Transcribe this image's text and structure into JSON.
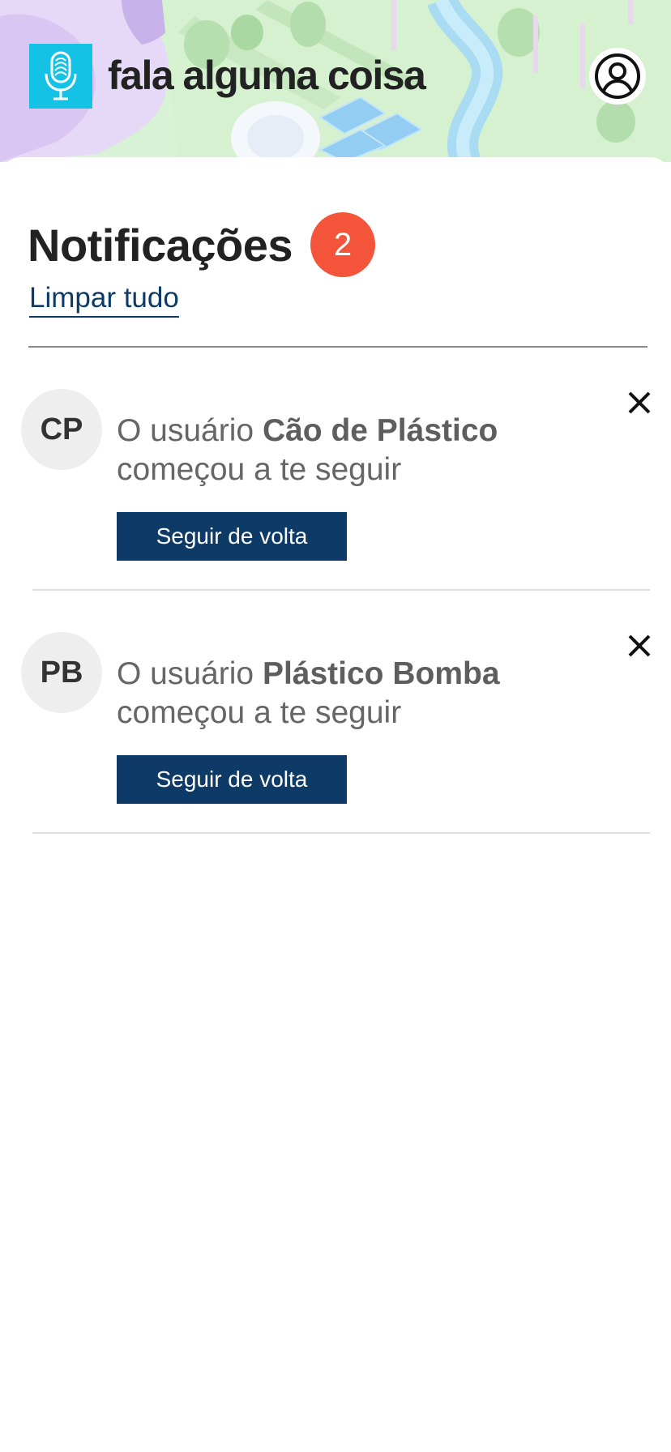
{
  "header": {
    "app_name": "fala alguma coisa",
    "logo_icon": "microphone-fingerprint-icon",
    "profile_icon": "user-circle-icon",
    "colors": {
      "logo_background": "#14c2e6"
    }
  },
  "notifications": {
    "title": "Notificações",
    "count": "2",
    "clear_all_label": "Limpar tudo",
    "items": [
      {
        "initials": "CP",
        "text_prefix": "O usuário",
        "user_name": "Cão de Plástico",
        "text_suffix": "começou a te seguir",
        "action_label": "Seguir de volta",
        "close_icon": "close-icon"
      },
      {
        "initials": "PB",
        "text_prefix": "O usuário",
        "user_name": "Plástico Bomba",
        "text_suffix": "começou a te seguir",
        "action_label": "Seguir de volta",
        "close_icon": "close-icon"
      }
    ]
  },
  "colors": {
    "badge": "#f4553a",
    "primary": "#0d3a66",
    "title_text": "#222222"
  }
}
